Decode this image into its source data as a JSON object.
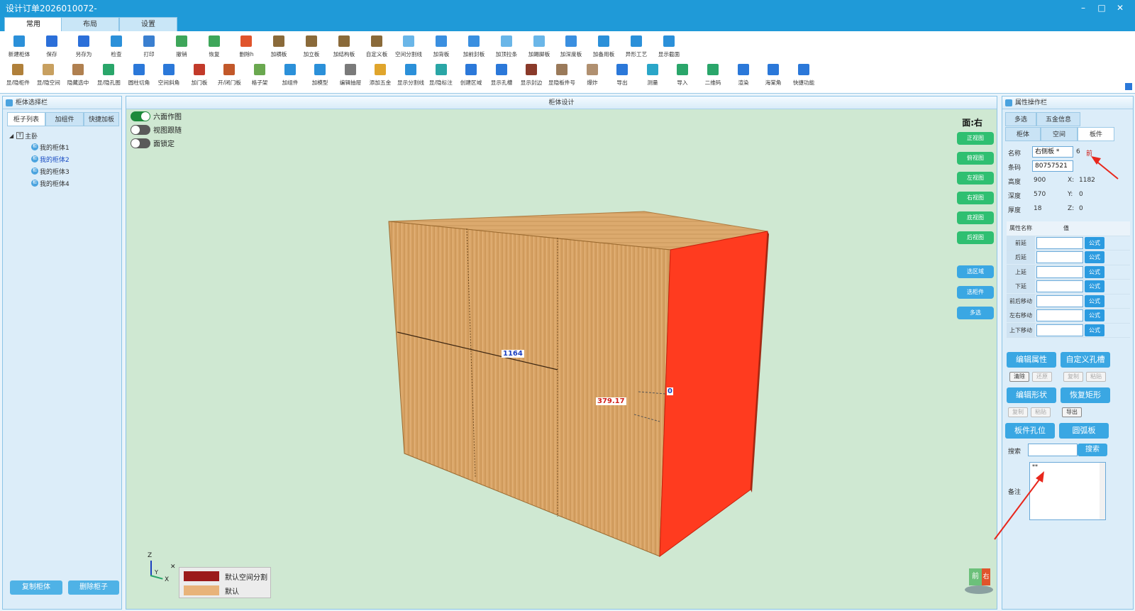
{
  "window": {
    "title": "设计订单2026010072-",
    "minimize": "–",
    "maximize": "□",
    "close": "✕"
  },
  "ribbon_tabs": [
    "常用",
    "布局",
    "设置"
  ],
  "toolbar_row1": [
    {
      "label": "新建柜体",
      "icon": "new-cabinet-icon",
      "color": "#2b90d9"
    },
    {
      "label": "保存",
      "icon": "save-icon",
      "color": "#2b6fd9"
    },
    {
      "label": "另存为",
      "icon": "save-as-icon",
      "color": "#2b6fd9"
    },
    {
      "label": "检查",
      "icon": "check-icon",
      "color": "#2b90d9"
    },
    {
      "label": "打印",
      "icon": "print-icon",
      "color": "#3a7fd0"
    },
    {
      "label": "撤销",
      "icon": "undo-icon",
      "color": "#3ea65a"
    },
    {
      "label": "恢复",
      "icon": "redo-icon",
      "color": "#3ea65a"
    },
    {
      "label": "删除h",
      "icon": "delete-icon",
      "color": "#e0542c"
    },
    {
      "label": "加横板",
      "icon": "add-horizontal-board-icon",
      "color": "#8a6a3a"
    },
    {
      "label": "加立板",
      "icon": "add-vertical-board-icon",
      "color": "#8a6a3a"
    },
    {
      "label": "加结构板",
      "icon": "add-structure-board-icon",
      "color": "#8a6a3a"
    },
    {
      "label": "自定义板",
      "icon": "custom-board-icon",
      "color": "#8a6a3a"
    },
    {
      "label": "空间分割线",
      "icon": "space-split-line-icon",
      "color": "#6ab6e8"
    },
    {
      "label": "加背板",
      "icon": "add-back-board-icon",
      "color": "#3a8fe0"
    },
    {
      "label": "加前封板",
      "icon": "add-front-seal-board-icon",
      "color": "#3a8fe0"
    },
    {
      "label": "加顶拉条",
      "icon": "add-top-strip-icon",
      "color": "#6ab6e8"
    },
    {
      "label": "加踢脚板",
      "icon": "add-kick-board-icon",
      "color": "#6ab6e8"
    },
    {
      "label": "加深度板",
      "icon": "add-depth-board-icon",
      "color": "#3a8fe0"
    },
    {
      "label": "加备用板",
      "icon": "add-spare-board-icon",
      "color": "#2b90d9"
    },
    {
      "label": "异形工艺",
      "icon": "special-shape-icon",
      "color": "#2b90d9"
    },
    {
      "label": "显示截面",
      "icon": "show-section-icon",
      "color": "#2b90d9"
    }
  ],
  "toolbar_row2": [
    {
      "label": "显/隐柜件",
      "icon": "show-hide-parts-icon",
      "color": "#b0803a"
    },
    {
      "label": "显/隐空间",
      "icon": "show-hide-space-icon",
      "color": "#c8a060"
    },
    {
      "label": "隐藏选中",
      "icon": "hide-selected-icon",
      "color": "#b08050"
    },
    {
      "label": "显/隐孔图",
      "icon": "show-hide-holes-icon",
      "color": "#2aa66a"
    },
    {
      "label": "圆柱切角",
      "icon": "cylinder-chamfer-icon",
      "color": "#2b78d9"
    },
    {
      "label": "空间斜角",
      "icon": "space-bevel-icon",
      "color": "#2b78d9"
    },
    {
      "label": "加门板",
      "icon": "add-door-icon",
      "color": "#c23a2a"
    },
    {
      "label": "开/闭门板",
      "icon": "open-close-door-icon",
      "color": "#c2582a"
    },
    {
      "label": "格子架",
      "icon": "grid-shelf-icon",
      "color": "#6aa84f"
    },
    {
      "label": "加组件",
      "icon": "add-component-icon",
      "color": "#2b90d9"
    },
    {
      "label": "加模型",
      "icon": "add-model-icon",
      "color": "#2b90d9"
    },
    {
      "label": "编辑抽屉",
      "icon": "edit-drawer-icon",
      "color": "#7a7a7a"
    },
    {
      "label": "添加五金",
      "icon": "add-hardware-icon",
      "color": "#e0a52c"
    },
    {
      "label": "显示分割线",
      "icon": "show-split-line-icon",
      "color": "#2b90d9"
    },
    {
      "label": "显/隐标注",
      "icon": "show-hide-dimension-icon",
      "color": "#2aa6a6"
    },
    {
      "label": "创建区域",
      "icon": "create-region-icon",
      "color": "#2b78d9"
    },
    {
      "label": "显示孔槽",
      "icon": "show-holes-slots-icon",
      "color": "#2b78d9"
    },
    {
      "label": "显示封边",
      "icon": "show-edge-band-icon",
      "color": "#8a3a2a"
    },
    {
      "label": "显隐板件号",
      "icon": "show-hide-board-no-icon",
      "color": "#9a7a5a"
    },
    {
      "label": "爆炸",
      "icon": "explode-icon",
      "color": "#b09070"
    },
    {
      "label": "导出",
      "icon": "export-icon",
      "color": "#2b78d9"
    },
    {
      "label": "测量",
      "icon": "measure-icon",
      "color": "#2aa6c8"
    },
    {
      "label": "导入",
      "icon": "import-icon",
      "color": "#2aa66a"
    },
    {
      "label": "二维码",
      "icon": "qrcode-icon",
      "color": "#2aa66a"
    },
    {
      "label": "渲染",
      "icon": "render-icon",
      "color": "#2b78d9"
    },
    {
      "label": "海棠角",
      "icon": "begonia-corner-icon",
      "color": "#2b78d9"
    },
    {
      "label": "快捷功能",
      "icon": "quick-function-icon",
      "color": "#2b78d9"
    }
  ],
  "left_panel": {
    "title": "柜体选择栏",
    "tabs": [
      "柜子列表",
      "加组件",
      "快捷加板"
    ],
    "tree_root": "主卧",
    "cabinets": [
      "我的柜体1",
      "我的柜体2",
      "我的柜体3",
      "我的柜体4"
    ],
    "node_icon_text": "柜",
    "copy_button": "复制柜体",
    "delete_button": "删除柜子"
  },
  "center_panel": {
    "title": "柜体设计",
    "toggles": [
      {
        "label": "六面作图",
        "on": true
      },
      {
        "label": "视图跟随",
        "on": false
      },
      {
        "label": "面锁定",
        "on": false
      }
    ],
    "face_label": "面:右",
    "view_buttons": [
      "正视图",
      "俯视图",
      "左视图",
      "右视图",
      "底视图",
      "后视图"
    ],
    "select_buttons": [
      "选区域",
      "选柜件",
      "多选"
    ],
    "dimensions": {
      "width_label": "1164",
      "gap_label": "379.17",
      "right_label": "0"
    },
    "axis": {
      "z": "Z",
      "y": "Y",
      "x": "X"
    },
    "legend": [
      {
        "label": "默认空间分割",
        "color": "#9b1a1a"
      },
      {
        "label": "默认",
        "color": "#e8b37a"
      }
    ],
    "nav_cube": {
      "front": "前",
      "right": "右"
    }
  },
  "right_panel": {
    "title": "属性操作栏",
    "tabs_row1": [
      "多选",
      "五金信息"
    ],
    "tabs_row2": [
      "柜体",
      "空间",
      "板件"
    ],
    "name_label": "名称",
    "name_value": "右侧板 *",
    "count_value": "6",
    "front_label": "前",
    "code_label": "条码",
    "code_value": "80757521",
    "height_label": "高度",
    "height_value": "900",
    "depth_label": "深度",
    "depth_value": "570",
    "thick_label": "厚度",
    "thick_value": "18",
    "x_label": "X:",
    "x_value": "1182",
    "y_label": "Y:",
    "y_value": "0",
    "z_label": "Z:",
    "z_value": "0",
    "table_header_name": "属性名称",
    "table_header_value": "值",
    "properties": [
      "前延",
      "后延",
      "上延",
      "下延",
      "前后移动",
      "左右移动",
      "上下移动"
    ],
    "formula_label": "公式",
    "edit_attr": "编辑属性",
    "custom_hole": "自定义孔槽",
    "clear": "清除",
    "restore": "还原",
    "copy": "复制",
    "paste": "粘贴",
    "edit_shape": "编辑形状",
    "restore_rect": "恢复矩形",
    "copy2": "复制",
    "paste2": "粘贴",
    "export": "导出",
    "board_hole": "板件孔位",
    "arc_board": "圆弧板",
    "search_label": "搜索",
    "search_button": "搜索",
    "note_label": "备注",
    "note_value": "**"
  }
}
